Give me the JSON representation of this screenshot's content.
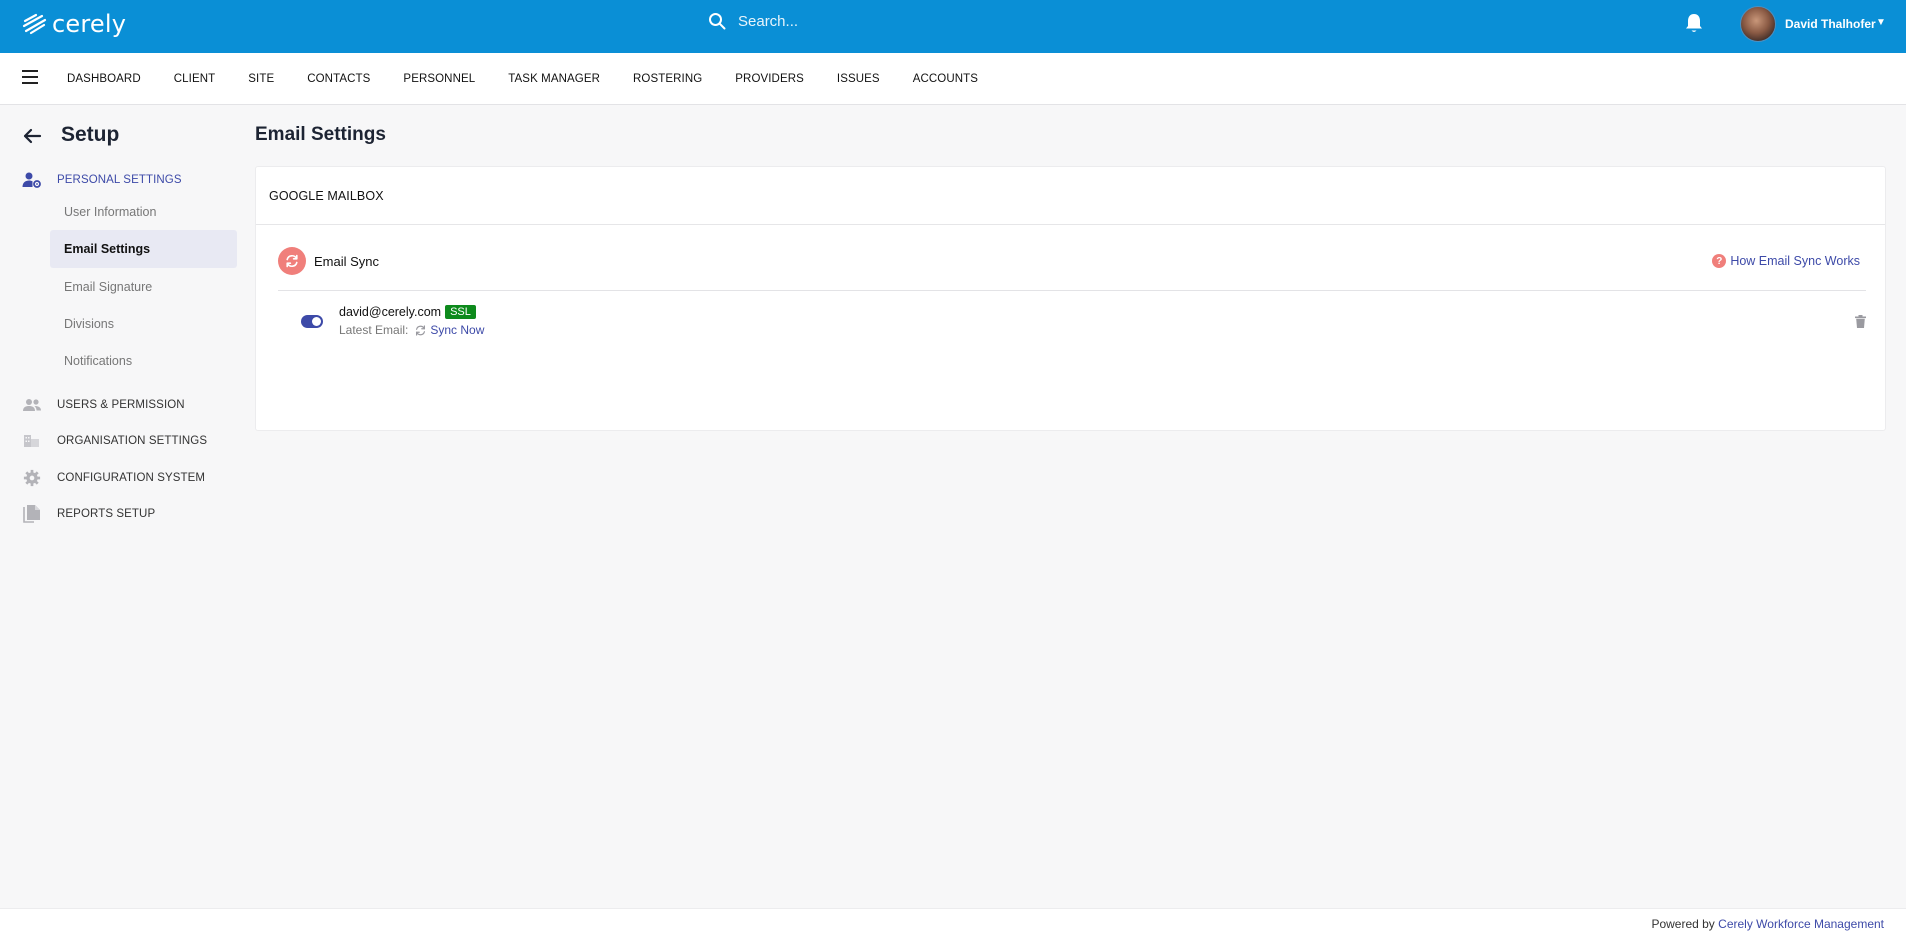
{
  "header": {
    "logo_text": "cerely",
    "search_placeholder": "Search...",
    "user_name": "David Thalhofer"
  },
  "nav": {
    "items": [
      "DASHBOARD",
      "CLIENT",
      "SITE",
      "CONTACTS",
      "PERSONNEL",
      "TASK MANAGER",
      "ROSTERING",
      "PROVIDERS",
      "ISSUES",
      "ACCOUNTS"
    ]
  },
  "sidebar": {
    "title": "Setup",
    "personal_settings": "PERSONAL SETTINGS",
    "sub_items": [
      "User Information",
      "Email Settings",
      "Email Signature",
      "Divisions",
      "Notifications"
    ],
    "users_permission": "USERS & PERMISSION",
    "organisation_settings": "ORGANISATION SETTINGS",
    "configuration_system": "CONFIGURATION SYSTEM",
    "reports_setup": "REPORTS SETUP"
  },
  "main": {
    "title": "Email Settings",
    "card_header": "GOOGLE MAILBOX",
    "sync_label": "Email Sync",
    "help_link": "How Email Sync Works",
    "account": {
      "email": "david@cerely.com",
      "badge": "SSL",
      "latest_label": "Latest Email:",
      "sync_now": "Sync Now",
      "sync_enabled": true
    }
  },
  "footer": {
    "prefix": "Powered by",
    "link": "Cerely Workforce Management"
  },
  "colors": {
    "brand_blue": "#0a8fd6",
    "accent_indigo": "#3d4aa8",
    "sync_red": "#f07f7b",
    "ssl_green": "#0d8a1c"
  }
}
